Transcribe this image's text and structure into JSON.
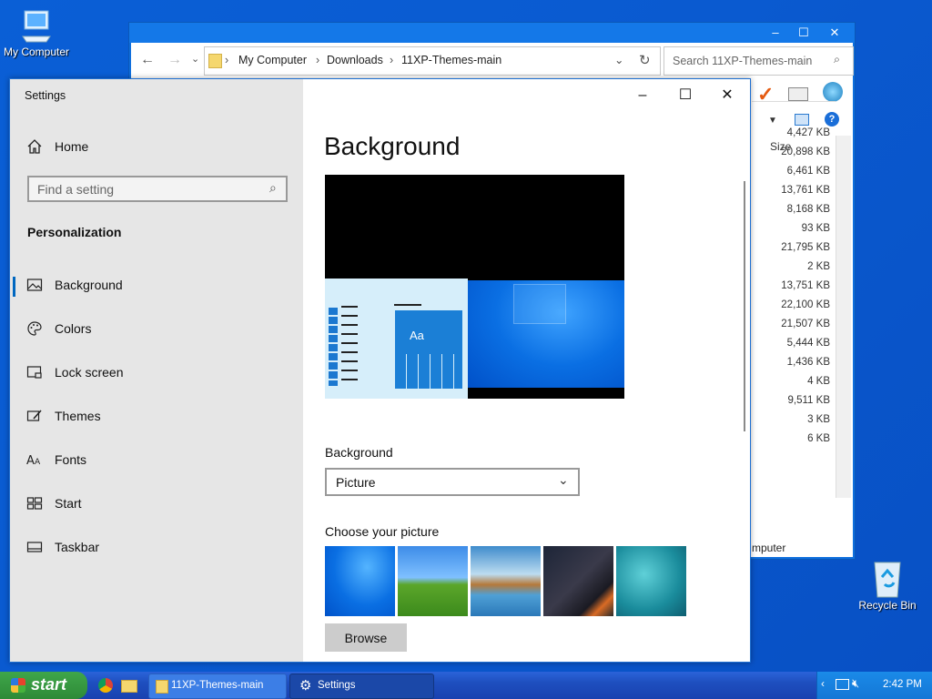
{
  "desktop": {
    "my_computer": "My Computer",
    "recycle_bin": "Recycle Bin"
  },
  "explorer": {
    "breadcrumb": [
      "My Computer",
      "Downloads",
      "11XP-Themes-main"
    ],
    "search_placeholder": "Search 11XP-Themes-main",
    "size_header": "Size",
    "sizes": [
      "4,427 KB",
      "20,898 KB",
      "6,461 KB",
      "13,761 KB",
      "8,168 KB",
      "93 KB",
      "21,795 KB",
      "2 KB",
      "13,751 KB",
      "22,100 KB",
      "21,507 KB",
      "5,444 KB",
      "1,436 KB",
      "4 KB",
      "9,511 KB",
      "3 KB",
      "6 KB"
    ],
    "status_text": "mputer"
  },
  "settings": {
    "window_title": "Settings",
    "home": "Home",
    "search_placeholder": "Find a setting",
    "section": "Personalization",
    "nav": [
      {
        "label": "Background",
        "icon": "image-icon"
      },
      {
        "label": "Colors",
        "icon": "palette-icon"
      },
      {
        "label": "Lock screen",
        "icon": "lock-screen-icon"
      },
      {
        "label": "Themes",
        "icon": "brush-icon"
      },
      {
        "label": "Fonts",
        "icon": "font-icon"
      },
      {
        "label": "Start",
        "icon": "start-icon"
      },
      {
        "label": "Taskbar",
        "icon": "taskbar-icon"
      }
    ],
    "page_title": "Background",
    "preview_sample": "Aa",
    "background_label": "Background",
    "background_value": "Picture",
    "choose_label": "Choose your picture",
    "browse": "Browse"
  },
  "taskbar": {
    "start": "start",
    "tasks": [
      "11XP-Themes-main",
      "Settings"
    ],
    "time": "2:42 PM"
  },
  "colors": {
    "accent": "#0067c0",
    "sidebar_bg": "#e6e6e6",
    "xp_blue": "#1e4fbf",
    "start_green": "#3a9a45"
  }
}
